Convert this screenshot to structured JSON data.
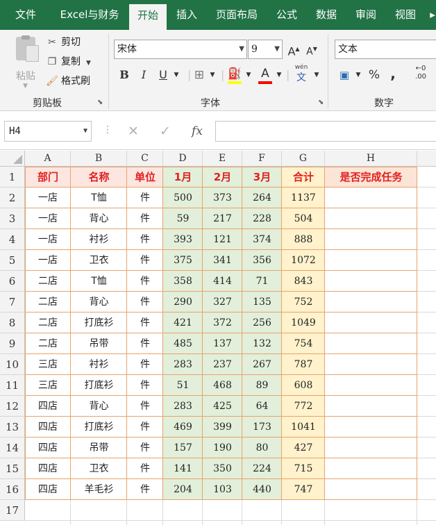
{
  "tabs": [
    "文件",
    "Excel与财务",
    "开始",
    "插入",
    "页面布局",
    "公式",
    "数据",
    "审阅",
    "视图"
  ],
  "active_tab": 2,
  "clipboard": {
    "paste": "粘贴",
    "cut": "剪切",
    "copy": "复制",
    "format_painter": "格式刷",
    "group_label": "剪贴板"
  },
  "font": {
    "name": "宋体",
    "size": "9",
    "bold": "B",
    "italic": "I",
    "underline": "U",
    "font_color_glyph": "A",
    "phonetic_top": "wén",
    "phonetic_bottom": "文",
    "group_label": "字体",
    "highlight_color": "#ffff00",
    "font_color": "#ff0000"
  },
  "number": {
    "format": "文本",
    "percent": "%",
    "comma": ",",
    "increase_decimal": "←0\n.00",
    "group_label": "数字"
  },
  "formula_bar": {
    "name_box": "H4",
    "fx": "fx",
    "value": ""
  },
  "columns": [
    "A",
    "B",
    "C",
    "D",
    "E",
    "F",
    "G",
    "H"
  ],
  "rows": [
    "1",
    "2",
    "3",
    "4",
    "5",
    "6",
    "7",
    "8",
    "9",
    "10",
    "11",
    "12",
    "13",
    "14",
    "15",
    "16",
    "17"
  ],
  "table": {
    "headers": [
      "部门",
      "名称",
      "单位",
      "1月",
      "2月",
      "3月",
      "合计",
      "是否完成任务"
    ],
    "data": [
      [
        "一店",
        "T恤",
        "件",
        "500",
        "373",
        "264",
        "1137",
        ""
      ],
      [
        "一店",
        "背心",
        "件",
        "59",
        "217",
        "228",
        "504",
        ""
      ],
      [
        "一店",
        "衬衫",
        "件",
        "393",
        "121",
        "374",
        "888",
        ""
      ],
      [
        "一店",
        "卫衣",
        "件",
        "375",
        "341",
        "356",
        "1072",
        ""
      ],
      [
        "二店",
        "T恤",
        "件",
        "358",
        "414",
        "71",
        "843",
        ""
      ],
      [
        "二店",
        "背心",
        "件",
        "290",
        "327",
        "135",
        "752",
        ""
      ],
      [
        "二店",
        "打底衫",
        "件",
        "421",
        "372",
        "256",
        "1049",
        ""
      ],
      [
        "二店",
        "吊带",
        "件",
        "485",
        "137",
        "132",
        "754",
        ""
      ],
      [
        "三店",
        "衬衫",
        "件",
        "283",
        "237",
        "267",
        "787",
        ""
      ],
      [
        "三店",
        "打底衫",
        "件",
        "51",
        "468",
        "89",
        "608",
        ""
      ],
      [
        "四店",
        "背心",
        "件",
        "283",
        "425",
        "64",
        "772",
        ""
      ],
      [
        "四店",
        "打底衫",
        "件",
        "469",
        "399",
        "173",
        "1041",
        ""
      ],
      [
        "四店",
        "吊带",
        "件",
        "157",
        "190",
        "80",
        "427",
        ""
      ],
      [
        "四店",
        "卫衣",
        "件",
        "141",
        "350",
        "224",
        "715",
        ""
      ],
      [
        "四店",
        "羊毛衫",
        "件",
        "204",
        "103",
        "440",
        "747",
        ""
      ]
    ]
  },
  "colors": {
    "ribbon_green": "#217346",
    "header_text_red": "#e02020",
    "header_fill_pink": "#fde6e0",
    "header_fill_green": "#e2efda",
    "header_fill_yellow": "#fff2cc",
    "header_fill_orange": "#fce4d6",
    "month_fill": "#e2efda",
    "total_fill": "#fff2cc",
    "border_orange": "#e8a36b"
  }
}
